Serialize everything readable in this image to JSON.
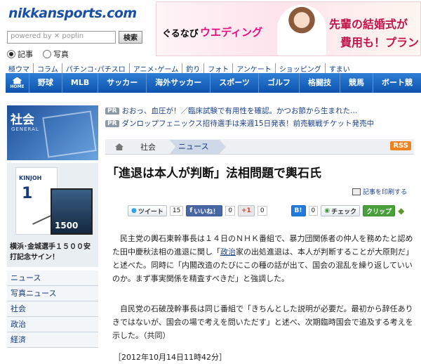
{
  "header": {
    "logo": "nikkansports.com",
    "search_placeholder": "powered by ✕ poplin",
    "search_button": "検索",
    "radio_article": "記事",
    "radio_photo": "写真"
  },
  "banner": {
    "brand": "ぐるなび",
    "wedding": "ウエディング",
    "line1": "先輩の結婚式が",
    "line2": "費用も！プラン"
  },
  "subnav": [
    "極ウマ",
    "コラム",
    "パチンコ･パチスロ",
    "アニメ･ゲーム",
    "釣り",
    "フォト",
    "アンケート",
    "ショッピング",
    "すまい"
  ],
  "mainnav": {
    "home_label": "HOME",
    "items": [
      "野球",
      "MLB",
      "サッカー",
      "海外サッカー",
      "スポーツ",
      "ゴルフ",
      "格闘技",
      "競馬",
      "ボート競"
    ]
  },
  "sidebar": {
    "section_title": "社会",
    "section_sub": "GENERAL",
    "jersey_name": "KINJOH",
    "jersey_number": "1",
    "card_number": "1500",
    "promo_text": "横浜･金城選手１５００安打記念サイン！",
    "items": [
      "ニュース",
      "写真ニュース",
      "社会",
      "政治",
      "経済"
    ]
  },
  "pr": [
    {
      "badge": "PR",
      "text": "おおっ、血圧が！／臨床試験で有用性を確認。かつお節から生まれた…"
    },
    {
      "badge": "PR",
      "text": "ダンロップフェニックス招待選手は来週15日発表！前売観戦チケット発売中"
    }
  ],
  "breadcrumb": {
    "item1": "社会",
    "item2": "ニュース",
    "rss": "RSS"
  },
  "article": {
    "headline": "「進退は本人が判断」法相問題で輿石氏",
    "print_link": "記事を印刷する",
    "paragraphs": [
      {
        "before": "　民主党の輿石東幹事長は１４日のＮＨＫ番組で、暴力団関係者の仲人を務めたと認めた田中慶秋法相の進退に関し「",
        "link": "政治",
        "after": "家の出処進退は、本人が判断することが大原則だ」と述べた。同時に「内閣改造のたびにこの種の話が出て、国会の混乱を繰り返していいのか。まず事実関係を精査すべきだ」と強調した。"
      },
      {
        "before": "　自民党の石破茂幹事長は同じ番組で「きちんとした説明が必要だ。最初から辞任ありきではないが、国会の場で考えを問いただす」と述べ、次期臨時国会で追及する考えを示した。（共同）",
        "link": "",
        "after": ""
      }
    ],
    "dateline": "［2012年10月14日11時42分］"
  },
  "share": {
    "tweet": "ツイート",
    "tweet_count": "15",
    "like": "いいね！",
    "like_count": "0",
    "gplus": "+1",
    "gplus_count": "0",
    "hatena": "B!",
    "hatena_count": "0",
    "check": "チェック",
    "clip": "クリップ"
  }
}
